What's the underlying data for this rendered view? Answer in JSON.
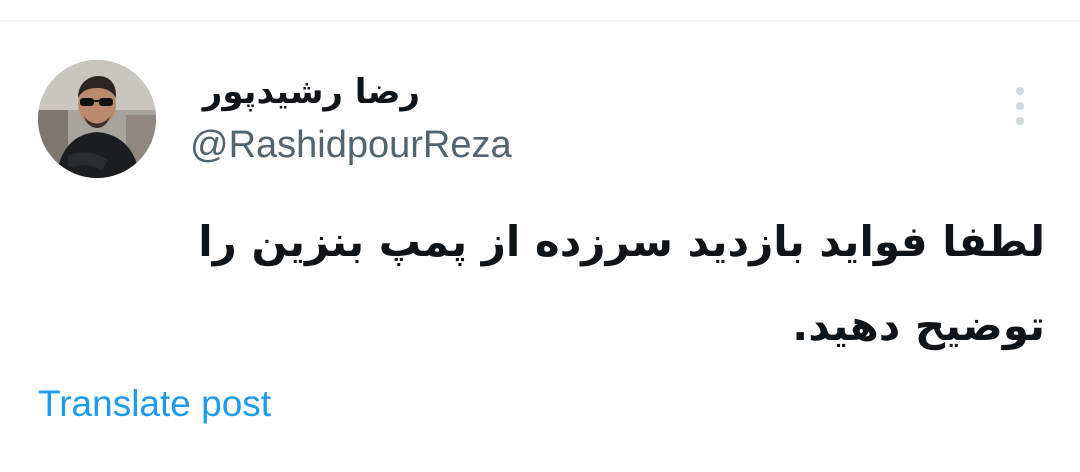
{
  "post": {
    "author": {
      "display_name": "رضا رشیدپور",
      "handle": "@RashidpourReza",
      "avatar_icon": "profile-photo"
    },
    "text": "لطفا فواید بازدید سرزده از پمپ بنزین را توضیح دهید.",
    "translate_label": "Translate post",
    "more_icon": "more-options-icon"
  },
  "colors": {
    "text_primary": "#0f1419",
    "text_secondary": "#536471",
    "link": "#1d9bf0",
    "divider": "#eff3f4"
  }
}
